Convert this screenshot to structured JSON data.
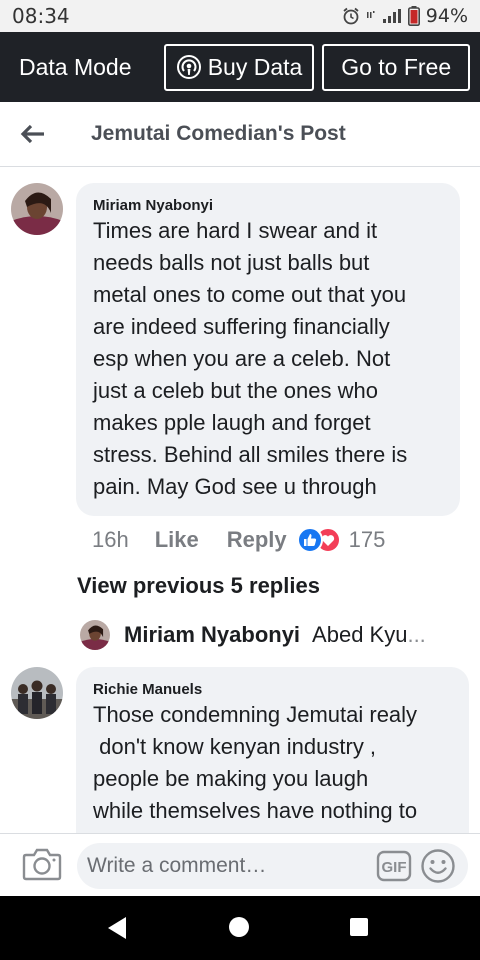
{
  "status_bar": {
    "time": "08:34",
    "battery": "94%",
    "icons": [
      "alarm-icon",
      "network-type-icon",
      "signal-icon",
      "battery-icon"
    ]
  },
  "data_bar": {
    "label": "Data Mode",
    "buy_label": "Buy Data",
    "free_label": "Go to Free",
    "buy_icon": "podcast-icon"
  },
  "header": {
    "back_icon": "arrow-left-icon",
    "title": "Jemutai Comedian's Post"
  },
  "comments": [
    {
      "author": "Miriam Nyabonyi",
      "text": "Times are hard I swear and it\nneeds balls not just balls but\nmetal ones to come out that you\nare indeed suffering financially\nesp when you are a celeb. Not\njust a celeb but the ones who\nmakes pple laugh and forget\nstress. Behind all smiles there is\npain. May God see u through",
      "time": "16h",
      "like_label": "Like",
      "reply_label": "Reply",
      "reaction_count": "175",
      "reactions": [
        "like-icon",
        "love-icon"
      ]
    },
    {
      "author": "Richie Manuels",
      "text": "Those condemning Jemutai realy\n don't know kenyan industry ,\npeople be making you laugh\nwhile themselves have nothing to"
    }
  ],
  "replies": {
    "view_previous_label": "View previous 5 replies",
    "preview_author": "Miriam Nyabonyi",
    "preview_text": "Abed Kyu",
    "preview_ellipsis": "..."
  },
  "composer": {
    "placeholder": "Write a comment…",
    "camera_icon": "camera-icon",
    "gif_icon": "gif-icon",
    "emoji_icon": "emoji-icon"
  },
  "colors": {
    "data_bar_bg": "#1f2227",
    "bubble_bg": "#f0f2f5",
    "like_blue": "#1877f2",
    "love_red": "#f33e58"
  }
}
